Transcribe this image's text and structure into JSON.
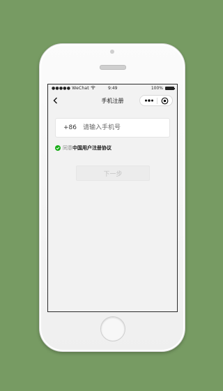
{
  "status_bar": {
    "carrier": "●●●●● WeChat",
    "time": "9:49",
    "battery_label": "100%"
  },
  "nav": {
    "title": "手机注册"
  },
  "form": {
    "country_code": "+86",
    "phone_placeholder": "请输入手机号",
    "phone_value": "",
    "agreement_prefix": "同意",
    "agreement_link": "中国用户注册协议",
    "agreement_checked": true,
    "next_label": "下一步"
  },
  "icons": {
    "back": "chevron-left-icon",
    "more": "more-dots-icon",
    "close": "target-close-icon",
    "check": "check-circle-icon",
    "wifi": "wifi-icon",
    "battery": "battery-icon"
  },
  "colors": {
    "background": "#779b63",
    "check_green": "#1aad19",
    "screen_bg": "#f2f2f2"
  }
}
